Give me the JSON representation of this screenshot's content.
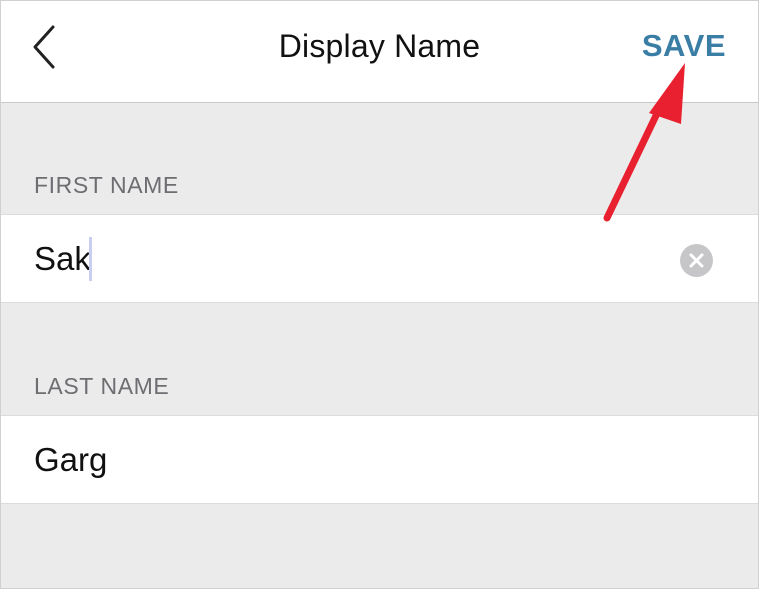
{
  "nav": {
    "title": "Display Name",
    "save_label": "SAVE",
    "back_icon": "chevron-left-icon"
  },
  "first_name": {
    "header": "FIRST NAME",
    "value": "Sak",
    "clear_icon": "clear-circle-icon"
  },
  "last_name": {
    "header": "LAST NAME",
    "value": "Garg"
  },
  "colors": {
    "accent": "#3a7ea6",
    "annotation_arrow": "#e8202f",
    "grouped_background": "#ebebeb",
    "section_header_text": "#6d6d72"
  }
}
